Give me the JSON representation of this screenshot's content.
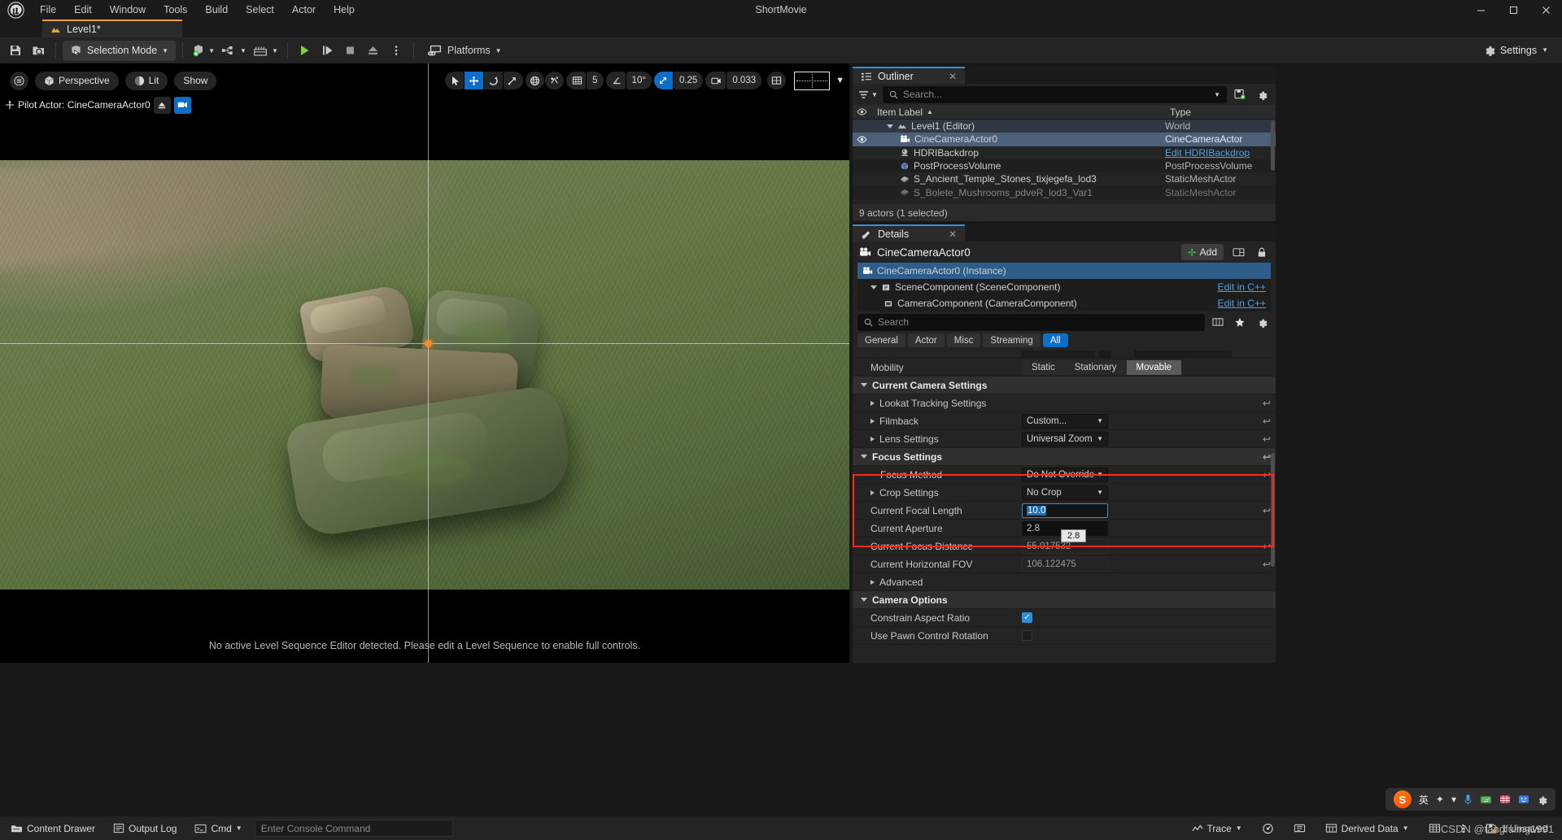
{
  "titlebar": {
    "menus": [
      "File",
      "Edit",
      "Window",
      "Tools",
      "Build",
      "Select",
      "Actor",
      "Help"
    ],
    "project_title": "ShortMovie",
    "minimize": "─",
    "maximize": "☐",
    "close": "✕"
  },
  "level_tab": {
    "label": "Level1*",
    "icon": "level-icon"
  },
  "toolbar": {
    "save_icon": "save-icon",
    "browse_icon": "browse-content-icon",
    "selection_mode": "Selection Mode",
    "add_icon": "add-actor-icon",
    "blueprint_icon": "blueprints-icon",
    "cinematics_icon": "cinematics-icon",
    "play_icon": "play-icon",
    "skip_icon": "skip-icon",
    "stop_icon": "stop-icon",
    "eject_icon": "eject-icon",
    "more_icon": "more-options-icon",
    "platforms": "Platforms",
    "settings": "Settings"
  },
  "viewport": {
    "menu_icon": "viewport-menu-icon",
    "perspective": "Perspective",
    "lit": "Lit",
    "show": "Show",
    "pilot_label": "Pilot Actor: CineCameraActor0",
    "message": "No active Level Sequence Editor detected. Please edit a Level Sequence to enable full controls.",
    "gizmos": {
      "select_icon": "select-tool-icon",
      "move_icon": "move-tool-icon",
      "rotate_icon": "rotate-tool-icon",
      "scale_icon": "scale-tool-icon",
      "world_icon": "world-coordinate-icon",
      "surface_snap_icon": "surface-snap-icon",
      "grid_snap_icon": "grid-snap-icon",
      "grid_value": "5",
      "angle_snap_icon": "angle-snap-icon",
      "angle_value": "10°",
      "scale_snap_icon": "scale-snap-icon",
      "scale_value": "0.25",
      "camera_speed_icon": "camera-speed-icon",
      "camera_speed_value": "0.033",
      "layout_icon": "viewport-layout-icon",
      "aspect_icon": "aspect-ratio-icon"
    }
  },
  "outliner": {
    "tab_label": "Outliner",
    "search_placeholder": "Search...",
    "columns": {
      "eye": "visibility",
      "label": "Item Label",
      "type": "Type"
    },
    "sort_indicator": "▲",
    "rows": [
      {
        "label": "Level1 (Editor)",
        "type": "World",
        "indent": 1,
        "icon": "level-icon",
        "state": "level",
        "eye": false,
        "expander": "open"
      },
      {
        "label": "CineCameraActor0",
        "type": "CineCameraActor",
        "indent": 2,
        "icon": "camera-icon",
        "state": "sel",
        "eye": true
      },
      {
        "label": "HDRIBackdrop",
        "type": "Edit HDRIBackdrop",
        "type_link": true,
        "indent": 2,
        "icon": "hdri-icon",
        "state": "",
        "eye": false
      },
      {
        "label": "PostProcessVolume",
        "type": "PostProcessVolume",
        "indent": 2,
        "icon": "volume-icon",
        "state": "alt",
        "eye": false
      },
      {
        "label": "S_Ancient_Temple_Stones_tixjegefa_lod3",
        "type": "StaticMeshActor",
        "indent": 2,
        "icon": "mesh-icon",
        "state": "",
        "eye": false
      },
      {
        "label": "S_Bolete_Mushrooms_pdveR_lod3_Var1",
        "type": "StaticMeshActor",
        "indent": 2,
        "icon": "mesh-icon",
        "state": "alt",
        "eye": false
      }
    ],
    "footer": "9 actors (1 selected)"
  },
  "details": {
    "tab_label": "Details",
    "actor_name": "CineCameraActor0",
    "add_label": "Add",
    "components": [
      {
        "label": "CineCameraActor0 (Instance)",
        "indent": 0,
        "selected": true,
        "cpp": "",
        "expander": "none",
        "icon": "camera-icon"
      },
      {
        "label": "SceneComponent (SceneComponent)",
        "indent": 1,
        "selected": false,
        "cpp": "Edit in C++",
        "expander": "open",
        "icon": "scene-component-icon"
      },
      {
        "label": "CameraComponent (CameraComponent)",
        "indent": 2,
        "selected": false,
        "cpp": "Edit in C++",
        "expander": "none",
        "icon": "camera-component-icon"
      }
    ],
    "search_placeholder": "Search",
    "filters": [
      "General",
      "Actor",
      "Misc",
      "Streaming",
      "All"
    ],
    "active_filter": "All",
    "properties": [
      {
        "kind": "prop",
        "name": "Mobility",
        "indent": 1,
        "control": "segmented",
        "options": [
          "Static",
          "Stationary",
          "Movable"
        ],
        "value": "Movable",
        "reset": false
      },
      {
        "kind": "cat",
        "name": "Current Camera Settings",
        "expander": "open"
      },
      {
        "kind": "prop",
        "name": "Lookat Tracking Settings",
        "indent": 1,
        "expander": "closed",
        "control": "none",
        "reset": true
      },
      {
        "kind": "prop",
        "name": "Filmback",
        "indent": 1,
        "expander": "closed",
        "control": "combo",
        "value": "Custom...",
        "reset": true
      },
      {
        "kind": "prop",
        "name": "Lens Settings",
        "indent": 1,
        "expander": "closed",
        "control": "combo",
        "value": "Universal Zoom",
        "reset": true
      },
      {
        "kind": "cat",
        "name": "Focus Settings",
        "expander": "open",
        "reset": true,
        "highlight": true
      },
      {
        "kind": "prop",
        "name": "Focus Method",
        "indent": 2,
        "control": "combo",
        "value": "Do Not Override",
        "reset": true,
        "highlight": true
      },
      {
        "kind": "prop",
        "name": "Crop Settings",
        "indent": 1,
        "expander": "closed",
        "control": "combo",
        "value": "No Crop",
        "reset": false,
        "highlight": true
      },
      {
        "kind": "prop",
        "name": "Current Focal Length",
        "indent": 1,
        "control": "numedit",
        "value": "10.0",
        "reset": true,
        "highlight": true
      },
      {
        "kind": "prop",
        "name": "Current Aperture",
        "indent": 1,
        "control": "num",
        "value": "2.8",
        "reset": false,
        "highlight": true,
        "tooltip": "2.8"
      },
      {
        "kind": "prop",
        "name": "Current Focus Distance",
        "indent": 1,
        "control": "num_ro",
        "value": "55.017532",
        "reset": true
      },
      {
        "kind": "prop",
        "name": "Current Horizontal FOV",
        "indent": 1,
        "control": "num_ro",
        "value": "106.122475",
        "reset": true
      },
      {
        "kind": "prop",
        "name": "Advanced",
        "indent": 1,
        "expander": "closed",
        "control": "none",
        "reset": false
      },
      {
        "kind": "cat",
        "name": "Camera Options",
        "expander": "open"
      },
      {
        "kind": "prop",
        "name": "Constrain Aspect Ratio",
        "indent": 1,
        "control": "check",
        "value": "on",
        "reset": false
      },
      {
        "kind": "prop",
        "name": "Use Pawn Control Rotation",
        "indent": 1,
        "control": "check",
        "value": "off",
        "reset": false
      }
    ]
  },
  "statusbar": {
    "content_drawer": "Content Drawer",
    "output_log": "Output Log",
    "cmd": "Cmd",
    "console_placeholder": "Enter Console Command",
    "trace": "Trace",
    "derived_data": "Derived Data",
    "unsaved": "1 Unsaved",
    "icons": {
      "drawer": "content-drawer-icon",
      "log": "output-log-icon",
      "cmd": "cmd-icon",
      "trace": "trace-icon",
      "perf": "performance-icon",
      "mem": "memory-icon",
      "dd": "derived-data-icon",
      "grid": "source-control-icon",
      "more": "status-more-icon",
      "save": "unsaved-icon"
    }
  },
  "ime": {
    "brand": "S",
    "mode": "英",
    "items": [
      "✦",
      "▾",
      "🎤",
      "⌨",
      "▦",
      "😊",
      "⚙"
    ]
  },
  "watermark": "CSDN @tangfuling1991",
  "colors": {
    "accent_blue": "#0d6ec8",
    "tab_underline": "#2f8fd8",
    "highlight_red": "#ff2a1f",
    "selection_blue": "#4d6079",
    "link_blue": "#4aa3e8",
    "orange": "#e8a33d"
  }
}
